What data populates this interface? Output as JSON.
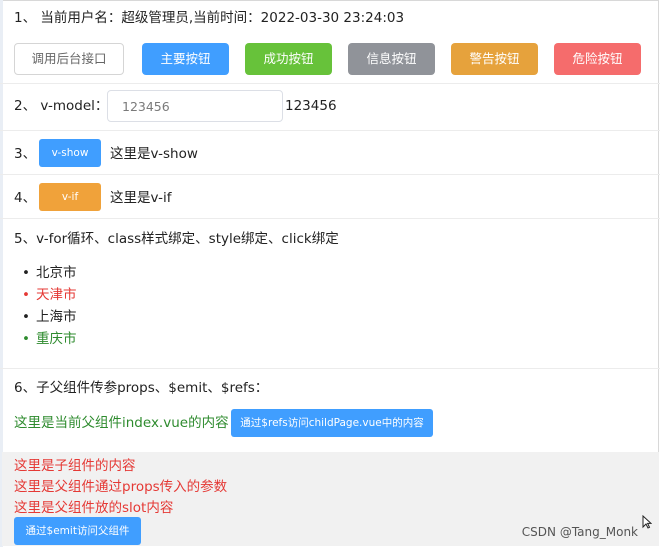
{
  "row1": {
    "label": "1、 当前用户名：超级管理员,当前时间：2022-03-30 23:24:03",
    "buttons": {
      "default": "调用后台接口",
      "primary": "主要按钮",
      "success": "成功按钮",
      "info": "信息按钮",
      "warning": "警告按钮",
      "danger": "危险按钮"
    }
  },
  "row2": {
    "label": "2、 v-model：",
    "input_value": "123456",
    "echo": "123456"
  },
  "row3": {
    "label": "3、",
    "button": "v-show",
    "text": "这里是v-show"
  },
  "row4": {
    "label": "4、",
    "button": "v-if",
    "text": "这里是v-if"
  },
  "row5": {
    "label": "5、v-for循环、class样式绑定、style绑定、click绑定",
    "cities": [
      {
        "name": "北京市",
        "color": "#222222"
      },
      {
        "name": "天津市",
        "color": "#e53935"
      },
      {
        "name": "上海市",
        "color": "#222222"
      },
      {
        "name": "重庆市",
        "color": "#2e8b2e"
      }
    ]
  },
  "row6": {
    "label": "6、子父组件传参props、$emit、$refs：",
    "parent_text": "这里是当前父组件index.vue的内容",
    "refs_button": "通过$refs访问childPage.vue中的内容"
  },
  "child": {
    "line1": "这里是子组件的内容",
    "line2": "这里是父组件通过props传入的参数",
    "line3": "这里是父组件放的slot内容",
    "emit_button": "通过$emit访问父组件"
  },
  "watermark": "CSDN @Tang_Monk"
}
